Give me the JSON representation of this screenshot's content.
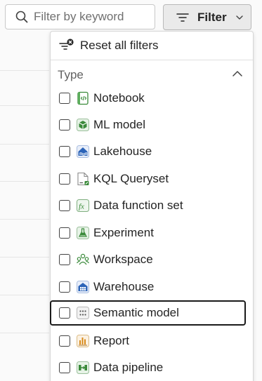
{
  "search": {
    "placeholder": "Filter by keyword"
  },
  "filter_button": {
    "label": "Filter"
  },
  "dropdown": {
    "reset_label": "Reset all filters",
    "section_title": "Type",
    "items": [
      {
        "label": "Notebook",
        "icon": "notebook-icon",
        "checked": false
      },
      {
        "label": "ML model",
        "icon": "ml-model-icon",
        "checked": false
      },
      {
        "label": "Lakehouse",
        "icon": "lakehouse-icon",
        "checked": false
      },
      {
        "label": "KQL Queryset",
        "icon": "kql-queryset-icon",
        "checked": false
      },
      {
        "label": "Data function set",
        "icon": "data-function-icon",
        "checked": false
      },
      {
        "label": "Experiment",
        "icon": "experiment-icon",
        "checked": false
      },
      {
        "label": "Workspace",
        "icon": "workspace-icon",
        "checked": false
      },
      {
        "label": "Warehouse",
        "icon": "warehouse-icon",
        "checked": false
      },
      {
        "label": "Semantic model",
        "icon": "semantic-model-icon",
        "checked": false,
        "focused": true
      },
      {
        "label": "Report",
        "icon": "report-icon",
        "checked": false
      },
      {
        "label": "Data pipeline",
        "icon": "data-pipeline-icon",
        "checked": false
      }
    ]
  },
  "colors": {
    "accent_green": "#3a8a3a",
    "accent_blue": "#2c64b8",
    "report_orange": "#d98a1a"
  }
}
